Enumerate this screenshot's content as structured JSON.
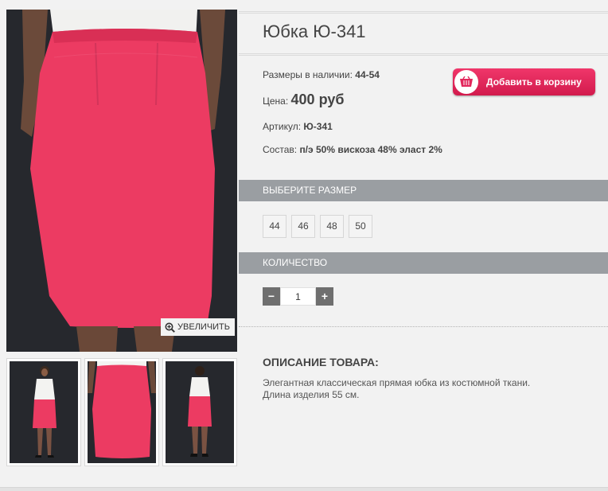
{
  "gallery": {
    "zoom_label": "УВЕЛИЧИТЬ",
    "zoom_icon": "magnifier-plus-icon",
    "thumbnails": [
      "front-view",
      "close-up",
      "back-view"
    ]
  },
  "product": {
    "title": "Юбка Ю-341",
    "sizes_label": "Размеры в наличии:",
    "sizes_value": "44-54",
    "price_label": "Цена:",
    "price_value": "400 руб",
    "article_label": "Артикул:",
    "article_value": "Ю-341",
    "composition_label": "Состав:",
    "composition_value": "п/э 50% вискоза 48% эласт 2%"
  },
  "cart": {
    "label": "Добавить в корзину",
    "icon": "basket-icon",
    "color": "#e2275c"
  },
  "size_section": {
    "heading": "ВЫБЕРИТЕ РАЗМЕР",
    "options": [
      "44",
      "46",
      "48",
      "50"
    ]
  },
  "quantity_section": {
    "heading": "КОЛИЧЕСТВО",
    "minus": "−",
    "plus": "+",
    "value": "1"
  },
  "description": {
    "title": "ОПИСАНИЕ ТОВАРА:",
    "line1": "Элегантная классическая прямая юбка из костюмной ткани.",
    "line2": "Длина изделия 55 см."
  }
}
